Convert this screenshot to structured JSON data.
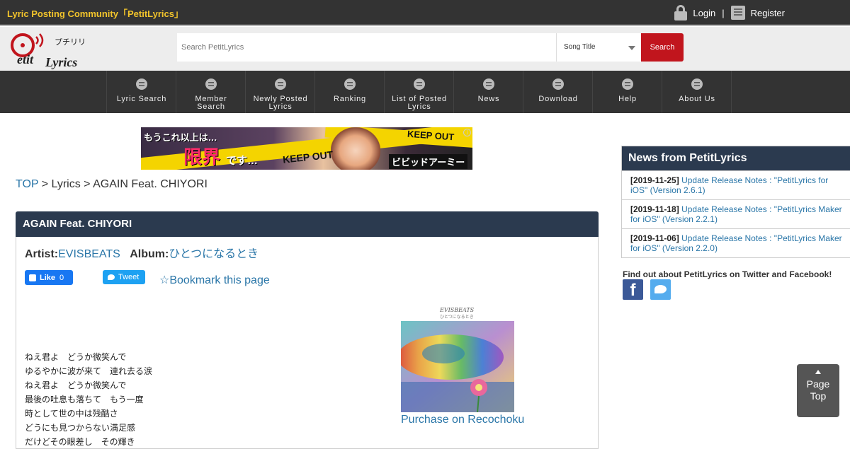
{
  "topbar": {
    "site_title": "Lyric Posting Community「PetitLyrics」",
    "login_label": "Login",
    "separator": "|",
    "register_label": "Register"
  },
  "header": {
    "logo_text_1": "etit",
    "logo_text_2": "Lyrics",
    "logo_kana": "プチリリ",
    "search_placeholder": "Search PetitLyrics",
    "search_type": "Song Title",
    "search_button": "Search"
  },
  "nav": {
    "items": [
      {
        "label_1": "Lyric Search",
        "label_2": "",
        "icon": "lyric-search-icon"
      },
      {
        "label_1": "Member",
        "label_2": "Search",
        "icon": "member-search-icon"
      },
      {
        "label_1": "Newly Posted",
        "label_2": "Lyrics",
        "icon": "newly-posted-icon"
      },
      {
        "label_1": "Ranking",
        "label_2": "",
        "icon": "ranking-icon"
      },
      {
        "label_1": "List of Posted",
        "label_2": "Lyrics",
        "icon": "list-icon"
      },
      {
        "label_1": "News",
        "label_2": "",
        "icon": "news-icon"
      },
      {
        "label_1": "Download",
        "label_2": "",
        "icon": "download-icon"
      },
      {
        "label_1": "Help",
        "label_2": "",
        "icon": "help-icon"
      },
      {
        "label_1": "About Us",
        "label_2": "",
        "icon": "about-icon"
      }
    ]
  },
  "banner": {
    "text_1": "もうこれ以上は…",
    "text_2": "限界",
    "text_3": "です…",
    "text_4": "KEEP OUT",
    "text_5": "KEEP OUT",
    "text_6": "ビビッドアーミー",
    "info": "i"
  },
  "breadcrumb": {
    "top": "TOP",
    "sep_1": " > ",
    "lyrics": "Lyrics",
    "sep_2": " > ",
    "current": "AGAIN Feat. CHIYORI"
  },
  "song": {
    "title": "AGAIN Feat. CHIYORI",
    "artist_label": "Artist:",
    "artist": "EVISBEATS",
    "album_label": "Album:",
    "album": "ひとつになるとき",
    "bookmark": "☆Bookmark this page",
    "purchase": "Purchase on Recochoku",
    "album_art_caption_1": "EVISBEATS",
    "album_art_caption_2": "ひとつになるとき",
    "lyrics": "ねえ君よ　どうか微笑んで\nゆるやかに波が来て　連れ去る涙\nねえ君よ　どうか微笑んで\n最後の吐息も落ちて　もう一度\n時として世の中は残酷さ\nどうにも見つからない満足感\nだけどその眼差し　その輝き"
  },
  "social_buttons": {
    "like": "Like",
    "like_count": "0",
    "tweet": "Tweet"
  },
  "sidebar": {
    "news_title": "News from PetitLyrics",
    "news": [
      {
        "date": "[2019-11-25]",
        "text": "Update Release Notes : \"PetitLyrics for iOS\" (Version 2.6.1)"
      },
      {
        "date": "[2019-11-18]",
        "text": "Update Release Notes : \"PetitLyrics Maker for iOS\" (Version 2.2.1)"
      },
      {
        "date": "[2019-11-06]",
        "text": "Update Release Notes : \"PetitLyrics Maker for iOS\" (Version 2.2.0)"
      }
    ],
    "social_text": "Find out about PetitLyrics on Twitter and Facebook!",
    "fb_glyph": "f"
  },
  "page_top": {
    "line_1": "Page",
    "line_2": "Top"
  },
  "colors": {
    "topbar_bg": "#333333",
    "title_yellow": "#f2c42b",
    "search_red": "#c1151d",
    "heading_navy": "#2b3a4f",
    "link_blue": "#2a76a8"
  }
}
